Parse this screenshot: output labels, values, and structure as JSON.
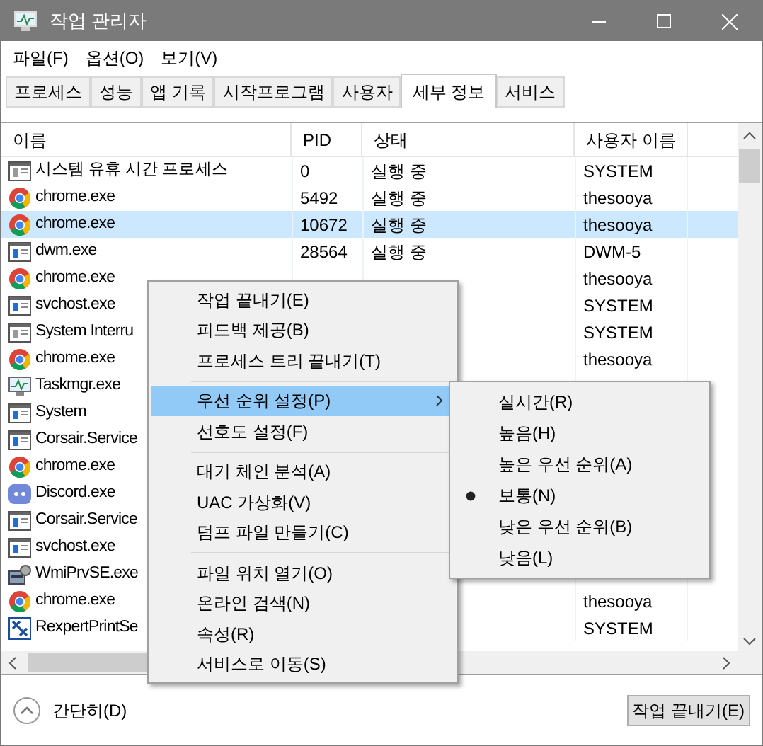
{
  "window": {
    "title": "작업 관리자"
  },
  "menu_bar": [
    "파일(F)",
    "옵션(O)",
    "보기(V)"
  ],
  "tabs": [
    {
      "label": "프로세스",
      "selected": false
    },
    {
      "label": "성능",
      "selected": false
    },
    {
      "label": "앱 기록",
      "selected": false
    },
    {
      "label": "시작프로그램",
      "selected": false
    },
    {
      "label": "사용자",
      "selected": false
    },
    {
      "label": "세부 정보",
      "selected": true
    },
    {
      "label": "서비스",
      "selected": false
    }
  ],
  "table": {
    "columns": [
      "이름",
      "PID",
      "상태",
      "사용자 이름"
    ],
    "rows": [
      {
        "kind": "window",
        "name": "시스템 유휴 시간 프로세스",
        "pid": "0",
        "status": "실행 중",
        "user": "SYSTEM",
        "selected": false
      },
      {
        "kind": "browser",
        "name": "chrome.exe",
        "pid": "5492",
        "status": "실행 중",
        "user": "thesooya",
        "selected": false
      },
      {
        "kind": "browser",
        "name": "chrome.exe",
        "pid": "10672",
        "status": "실행 중",
        "user": "thesooya",
        "selected": true
      },
      {
        "kind": "app",
        "name": "dwm.exe",
        "pid": "28564",
        "status": "실행 중",
        "user": "DWM-5",
        "selected": false
      },
      {
        "kind": "browser",
        "name": "chrome.exe",
        "user": "thesooya",
        "selected": false
      },
      {
        "kind": "app",
        "name": "svchost.exe",
        "user": "SYSTEM",
        "selected": false
      },
      {
        "kind": "window",
        "name": "System Interru",
        "user": "SYSTEM",
        "selected": false
      },
      {
        "kind": "browser",
        "name": "chrome.exe",
        "user": "thesooya",
        "selected": false
      },
      {
        "kind": "monitor",
        "name": "Taskmgr.exe",
        "selected": false
      },
      {
        "kind": "app",
        "name": "System",
        "selected": false
      },
      {
        "kind": "app",
        "name": "Corsair.Service",
        "selected": false
      },
      {
        "kind": "browser",
        "name": "chrome.exe",
        "selected": false
      },
      {
        "kind": "chat",
        "name": "Discord.exe",
        "selected": false
      },
      {
        "kind": "app",
        "name": "Corsair.Service",
        "selected": false
      },
      {
        "kind": "app",
        "name": "svchost.exe",
        "selected": false
      },
      {
        "kind": "tool",
        "name": "WmiPrvSE.exe",
        "selected": false
      },
      {
        "kind": "browser",
        "name": "chrome.exe",
        "user": "thesooya",
        "selected": false
      },
      {
        "kind": "print",
        "name": "RexpertPrintSe",
        "user": "SYSTEM",
        "selected": false
      }
    ]
  },
  "context_menu": {
    "items": [
      {
        "kind": "item",
        "label": "작업 끝내기(E)",
        "selected": false
      },
      {
        "kind": "item",
        "label": "피드백 제공(B)",
        "selected": false
      },
      {
        "kind": "item",
        "label": "프로세스 트리 끝내기(T)",
        "selected": false
      },
      {
        "kind": "separator"
      },
      {
        "kind": "submenu",
        "label": "우선 순위 설정(P)",
        "selected": true
      },
      {
        "kind": "item",
        "label": "선호도 설정(F)",
        "selected": false
      },
      {
        "kind": "separator"
      },
      {
        "kind": "item",
        "label": "대기 체인 분석(A)",
        "selected": false
      },
      {
        "kind": "item",
        "label": "UAC 가상화(V)",
        "selected": false
      },
      {
        "kind": "item",
        "label": "덤프 파일 만들기(C)",
        "selected": false
      },
      {
        "kind": "separator"
      },
      {
        "kind": "item",
        "label": "파일 위치 열기(O)",
        "selected": false
      },
      {
        "kind": "item",
        "label": "온라인 검색(N)",
        "selected": false
      },
      {
        "kind": "item",
        "label": "속성(R)",
        "selected": false
      },
      {
        "kind": "item",
        "label": "서비스로 이동(S)",
        "selected": false
      }
    ]
  },
  "priority_submenu": [
    {
      "label": "실시간(R)",
      "selected": false
    },
    {
      "label": "높음(H)",
      "selected": false
    },
    {
      "label": "높은 우선 순위(A)",
      "selected": false
    },
    {
      "label": "보통(N)",
      "selected": true
    },
    {
      "label": "낮은 우선 순위(B)",
      "selected": false
    },
    {
      "label": "낮음(L)",
      "selected": false
    }
  ],
  "footer": {
    "collapse": "간단히(D)",
    "end_task": "작업 끝내기(E)"
  }
}
